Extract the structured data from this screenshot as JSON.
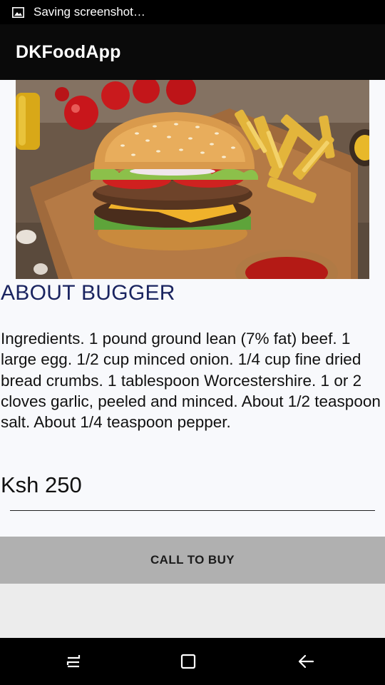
{
  "status_bar": {
    "notification_icon": "image-icon",
    "text": "Saving screenshot…"
  },
  "app_bar": {
    "title": "DKFoodApp"
  },
  "hero": {
    "image_subject": "burger with fries"
  },
  "product": {
    "title": "ABOUT BUGGER",
    "description": "Ingredients. 1 pound ground lean (7% fat) beef. 1 large egg. 1/2 cup minced onion. 1/4 cup fine dried bread crumbs. 1 tablespoon Worcestershire. 1 or 2 cloves garlic, peeled and minced. About 1/2 teaspoon salt. About 1/4 teaspoon pepper.",
    "price": "Ksh 250",
    "title_color": "#1a2460"
  },
  "actions": {
    "buy_label": "CALL TO BUY"
  },
  "nav_bar": {
    "recents_icon": "recents-icon",
    "home_icon": "home-icon",
    "back_icon": "back-icon"
  }
}
